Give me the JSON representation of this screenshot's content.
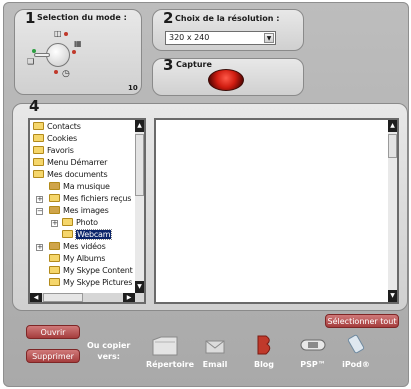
{
  "panel1": {
    "num": "1",
    "title": "Selection du mode :",
    "value": "10"
  },
  "panel2": {
    "num": "2",
    "title": "Choix de la résolution :",
    "selected": "320 x 240"
  },
  "panel3": {
    "num": "3",
    "title": "Capture"
  },
  "panel4": {
    "num": "4"
  },
  "tree": {
    "items": [
      {
        "label": "Contacts"
      },
      {
        "label": "Cookies"
      },
      {
        "label": "Favoris"
      },
      {
        "label": "Menu Démarrer"
      },
      {
        "label": "Mes documents"
      },
      {
        "label": "Ma musique"
      },
      {
        "label": "Mes fichiers reçus"
      },
      {
        "label": "Mes images"
      },
      {
        "label": "Photo"
      },
      {
        "label": "Webcam"
      },
      {
        "label": "Mes vidéos"
      },
      {
        "label": "My Albums"
      },
      {
        "label": "My Skype Content"
      },
      {
        "label": "My Skype Pictures"
      }
    ]
  },
  "buttons": {
    "select_all": "Sélectionner tout",
    "open": "Ouvrir",
    "delete": "Supprimer"
  },
  "copy": {
    "line1": "Ou copier",
    "line2": "vers:"
  },
  "destinations": [
    {
      "label": "Répertoire",
      "icon": "folder-icon"
    },
    {
      "label": "Email",
      "icon": "envelope-icon"
    },
    {
      "label": "Blog",
      "icon": "blog-icon"
    },
    {
      "label": "PSP™",
      "icon": "psp-icon"
    },
    {
      "label": "iPod®",
      "icon": "ipod-icon"
    }
  ]
}
